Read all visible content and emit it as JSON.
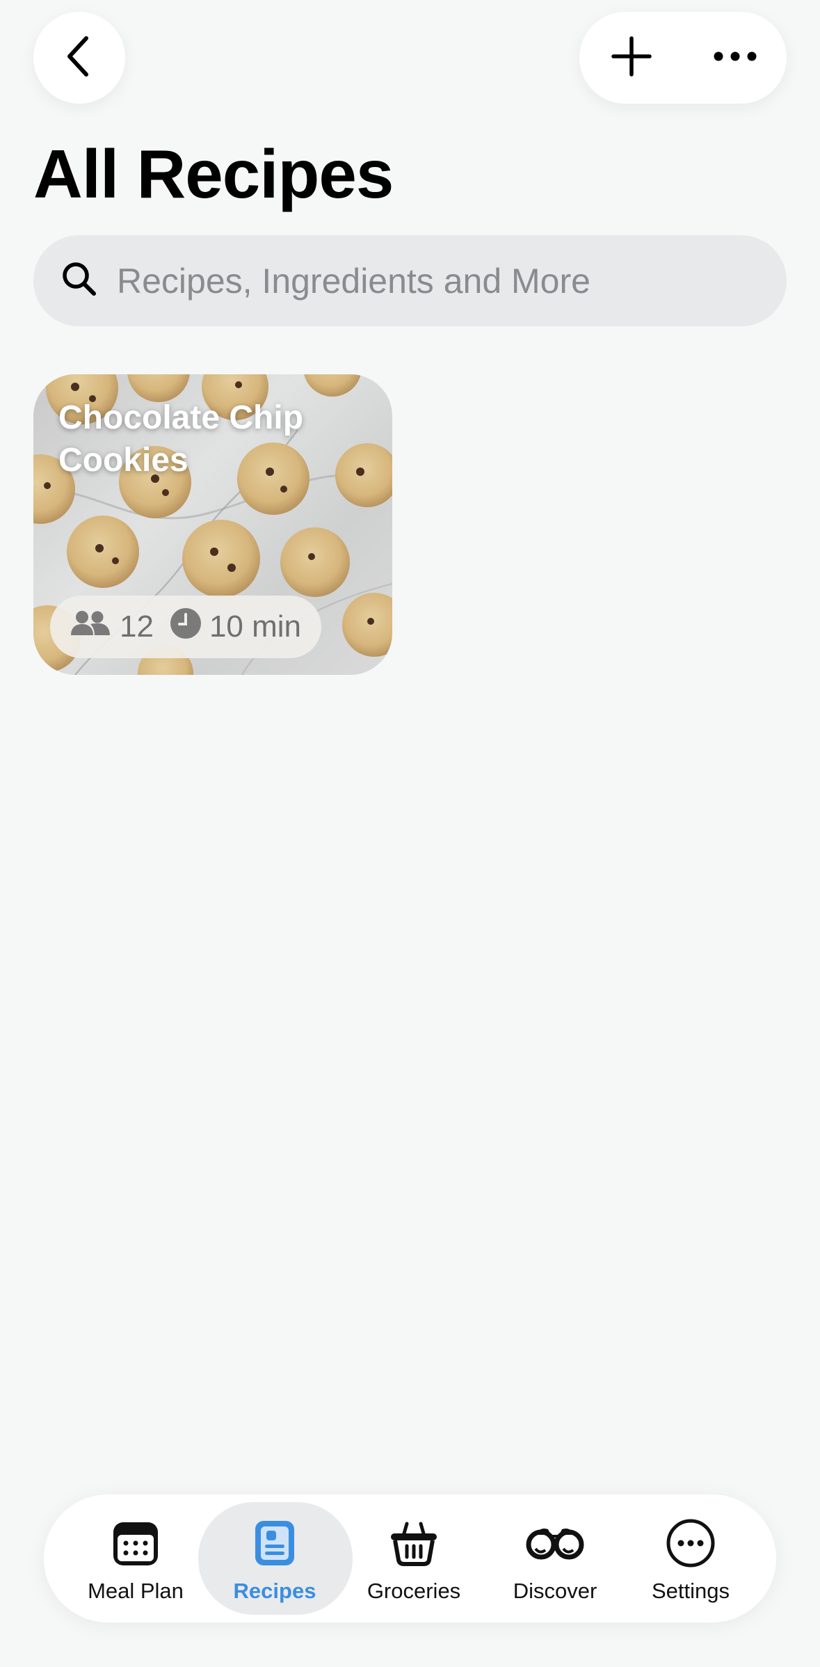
{
  "header": {
    "back_icon": "chevron-left-icon",
    "add_icon": "plus-icon",
    "more_icon": "ellipsis-icon",
    "title": "All Recipes"
  },
  "search": {
    "placeholder": "Recipes, Ingredients and More",
    "value": "",
    "icon": "search-icon"
  },
  "recipes": [
    {
      "title": "Chocolate Chip Cookies",
      "servings": "12",
      "time": "10 min",
      "servings_icon": "people-icon",
      "time_icon": "clock-icon"
    }
  ],
  "tabbar": {
    "active_color": "#3a8ee0",
    "items": [
      {
        "label": "Meal Plan",
        "icon": "calendar-icon",
        "active": false
      },
      {
        "label": "Recipes",
        "icon": "recipe-book-icon",
        "active": true
      },
      {
        "label": "Groceries",
        "icon": "basket-icon",
        "active": false
      },
      {
        "label": "Discover",
        "icon": "binoculars-icon",
        "active": false
      },
      {
        "label": "Settings",
        "icon": "more-circle-icon",
        "active": false
      }
    ]
  }
}
